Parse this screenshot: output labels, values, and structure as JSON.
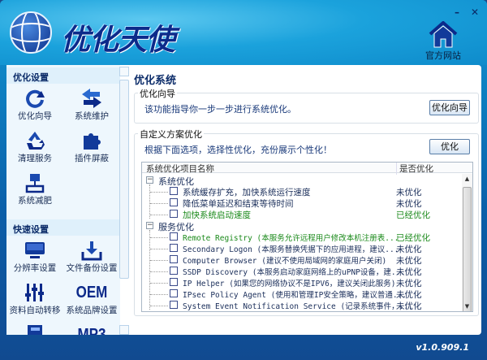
{
  "app": {
    "title": "优化天使",
    "home_label": "官方网站",
    "version": "v1.0.909.1",
    "minimize": "–",
    "close": "✕"
  },
  "sidebar": {
    "sections": [
      {
        "title": "优化设置",
        "items": [
          {
            "label": "优化向导",
            "icon": "refresh-arrow-icon"
          },
          {
            "label": "系统维护",
            "icon": "swap-arrows-icon"
          },
          {
            "label": "清理服务",
            "icon": "recycle-icon"
          },
          {
            "label": "插件屏蔽",
            "icon": "puzzle-icon"
          },
          {
            "label": "系统减肥",
            "icon": "scale-icon"
          }
        ]
      },
      {
        "title": "快速设置",
        "items": [
          {
            "label": "分辨率设置",
            "icon": "monitor-icon"
          },
          {
            "label": "文件备份设置",
            "icon": "download-icon"
          },
          {
            "label": "资料自动转移",
            "icon": "sliders-icon"
          },
          {
            "label": "系统品牌设置",
            "icon": "oem-icon",
            "glyph": "OEM"
          },
          {
            "label": "",
            "icon": "notebook-icon"
          },
          {
            "label": "",
            "icon": "mp3-icon",
            "glyph": "MP3"
          }
        ]
      }
    ]
  },
  "main": {
    "title": "优化系统",
    "wizard": {
      "group": "优化向导",
      "text": "该功能指导你一步一步进行系统优化。",
      "button": "优化向导"
    },
    "custom": {
      "group": "自定义方案优化",
      "text": "根据下面选项，选择性优化，充份展示个性化！",
      "button": "优化",
      "columns": [
        "系统优化项目名称",
        "是否优化"
      ],
      "groups": [
        {
          "name": "系统优化",
          "expander": "−",
          "rows": [
            {
              "name": "系统缓存扩充，加快系统运行速度",
              "status": "未优化",
              "done": false
            },
            {
              "name": "降低菜单延迟和结束等待时间",
              "status": "未优化",
              "done": false
            },
            {
              "name": "加快系统启动速度",
              "status": "已经优化",
              "done": true
            }
          ]
        },
        {
          "name": "服务优化",
          "expander": "−",
          "rows": [
            {
              "name": "Remote Registry (本服务允许远程用户修改本机注册表...",
              "status": "已经优化",
              "done": true
            },
            {
              "name": "Secondary Logon (本服务替换凭据下的应用进程，建议...",
              "status": "未优化",
              "done": false
            },
            {
              "name": "Computer Browser (建议不使用局域网的家庭用户关闭)",
              "status": "未优化",
              "done": false
            },
            {
              "name": "SSDP Discovery (本服务启动家庭网络上的uPNP设备，建...",
              "status": "未优化",
              "done": false
            },
            {
              "name": "IP Helper (如果您的网络协议不是IPV6，建议关闭此服务)",
              "status": "未优化",
              "done": false
            },
            {
              "name": "IPsec Policy Agent (使用和管理IP安全策略，建议普通...",
              "status": "未优化",
              "done": false
            },
            {
              "name": "System Event Notification Service (记录系统事件，...",
              "status": "未优化",
              "done": false
            }
          ]
        }
      ]
    }
  },
  "colors": {
    "accent": "#0d2d6a",
    "done": "#1b8a1b",
    "pending": "#1a2e5a"
  }
}
